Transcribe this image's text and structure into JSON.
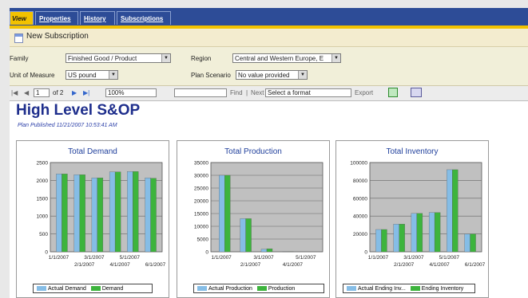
{
  "tabs": [
    "View",
    "Properties",
    "History",
    "Subscriptions"
  ],
  "subscription_label": "New Subscription",
  "params": {
    "family_label": "Family",
    "family_value": "Finished Good / Product",
    "region_label": "Region",
    "region_value": "Central and Western Europe, E",
    "uom_label": "Unit of Measure",
    "uom_value": "US pound",
    "scenario_label": "Plan Scenario",
    "scenario_value": "No value provided"
  },
  "report_toolbar": {
    "page": "1",
    "of_pages": "of 2",
    "zoom": "100%",
    "find": "Find",
    "sep": "|",
    "next": "Next",
    "format": "Select a format",
    "export": "Export"
  },
  "report": {
    "title": "High Level S&OP",
    "published": "Plan Published 11/21/2007 10:53:41 AM"
  },
  "colors": {
    "actual": "#85bde6",
    "plan": "#3db43d",
    "plot_bg": "#c0c0c0",
    "title": "#1e3e9b"
  },
  "chart_data": [
    {
      "type": "bar",
      "title": "Total Demand",
      "ylim": [
        0,
        2500
      ],
      "yticks": [
        "0",
        "500",
        "1000",
        "1500",
        "2000",
        "2500"
      ],
      "categories": [
        "1/1/2007",
        "2/1/2007",
        "3/1/2007",
        "4/1/2007",
        "5/1/2007",
        "6/1/2007"
      ],
      "series": [
        {
          "name": "Actual Demand",
          "values": [
            2180,
            2160,
            2070,
            2240,
            2250,
            2070
          ]
        },
        {
          "name": "Demand",
          "values": [
            2180,
            2160,
            2070,
            2240,
            2250,
            2060
          ]
        }
      ]
    },
    {
      "type": "bar",
      "title": "Total Production",
      "ylim": [
        0,
        35000
      ],
      "yticks": [
        "0",
        "5000",
        "10000",
        "15000",
        "20000",
        "25000",
        "30000",
        "35000"
      ],
      "categories": [
        "1/1/2007",
        "2/1/2007",
        "3/1/2007",
        "4/1/2007",
        "5/1/2007"
      ],
      "series": [
        {
          "name": "Actual Production",
          "values": [
            30000,
            13000,
            1000,
            100,
            0
          ]
        },
        {
          "name": "Production",
          "values": [
            30000,
            13000,
            1200,
            100,
            0
          ]
        }
      ]
    },
    {
      "type": "bar",
      "title": "Total Inventory",
      "ylim": [
        0,
        100000
      ],
      "yticks": [
        "0",
        "20000",
        "40000",
        "60000",
        "80000",
        "100000"
      ],
      "categories": [
        "1/1/2007",
        "2/1/2007",
        "3/1/2007",
        "4/1/2007",
        "5/1/2007",
        "6/1/2007"
      ],
      "series": [
        {
          "name": "Actual  Ending Inv...",
          "values": [
            25000,
            31000,
            43000,
            44000,
            92000,
            20000
          ]
        },
        {
          "name": "Ending Inventory",
          "values": [
            25000,
            31000,
            43000,
            44000,
            92000,
            20000
          ]
        }
      ]
    }
  ]
}
